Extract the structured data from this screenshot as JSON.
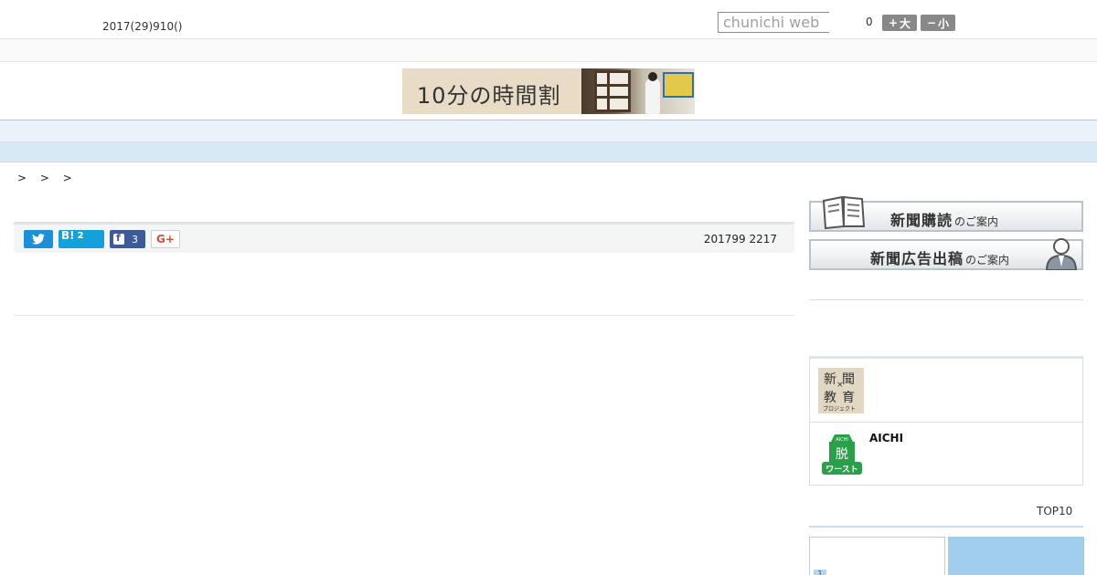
{
  "header": {
    "date_text": "2017(29)910()",
    "search": {
      "placeholder": "chunichi web",
      "value": ""
    },
    "font_size": {
      "value": "0",
      "larger_label": "大",
      "smaller_label": "小",
      "larger_symbol": "+",
      "smaller_symbol": "−"
    }
  },
  "banner": {
    "text": "10分の時間割"
  },
  "nav": {
    "items": [
      "",
      "",
      "",
      "",
      "",
      "",
      "",
      "",
      ""
    ]
  },
  "breadcrumb": {
    "separators": [
      ">",
      ">",
      ">"
    ]
  },
  "share": {
    "hatena_label": "B!",
    "hatena_count": "2",
    "facebook_count": "3",
    "google_label": "G+",
    "article_date": "201799 2217"
  },
  "sidebar": {
    "subscription": {
      "main": "新聞購読",
      "sub": "のご案内"
    },
    "advertising": {
      "main": "新聞広告出稿",
      "sub": "のご案内"
    },
    "edu_logo": {
      "row1": "新聞",
      "cross": "×",
      "row2": "教育",
      "row3": "プロジェクト"
    },
    "aichi": {
      "title": "AICHI",
      "logo_top": "AICHI",
      "logo_mid": "脱",
      "logo_bottom": "ワースト"
    },
    "ranking": {
      "link_label": "TOP10",
      "first_rank": "1"
    }
  },
  "colors": {
    "nav_background": "#eaf2fa",
    "subnav_background": "#d8e9f6",
    "twitter": "#1d8fd8",
    "hatena": "#14a0d9",
    "facebook": "#3d5b99",
    "google": "#dd4b39",
    "aichi_green": "#2aa04a"
  }
}
